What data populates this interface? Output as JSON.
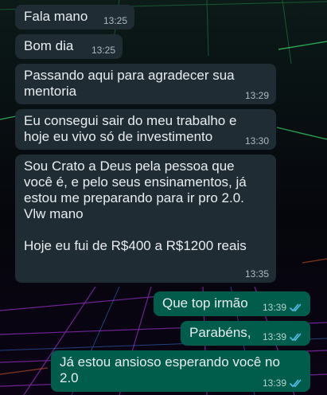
{
  "messages": [
    {
      "direction": "in",
      "text": "Fala mano",
      "time": "13:25"
    },
    {
      "direction": "in",
      "text": "Bom dia",
      "time": "13:25"
    },
    {
      "direction": "in",
      "text": "Passando aqui para agradecer sua\nmentoria",
      "time": "13:29"
    },
    {
      "direction": "in",
      "text": "Eu consegui sair do meu trabalho e\nhoje eu vivo só de investimento",
      "time": "13:30"
    },
    {
      "direction": "in",
      "text": "Sou Crato a Deus pela pessoa que\nvocê é, e pelo seus ensinamentos, já\nestou me preparando para ir pro 2.0.\nVlw mano\n\nHoje eu fui de R$400 a R$1200 reais",
      "time": "13:35"
    },
    {
      "direction": "out",
      "text": "Que top irmão",
      "time": "13:39",
      "status": "read"
    },
    {
      "direction": "out",
      "text": "Parabéns,",
      "time": "13:39",
      "status": "read"
    },
    {
      "direction": "out",
      "text": "Já estou ansioso esperando você no\n2.0",
      "time": "13:39",
      "status": "read"
    }
  ],
  "colors": {
    "incoming_bubble": "#1f2c34",
    "outgoing_bubble": "#005c4b",
    "read_ticks": "#53bdeb"
  }
}
